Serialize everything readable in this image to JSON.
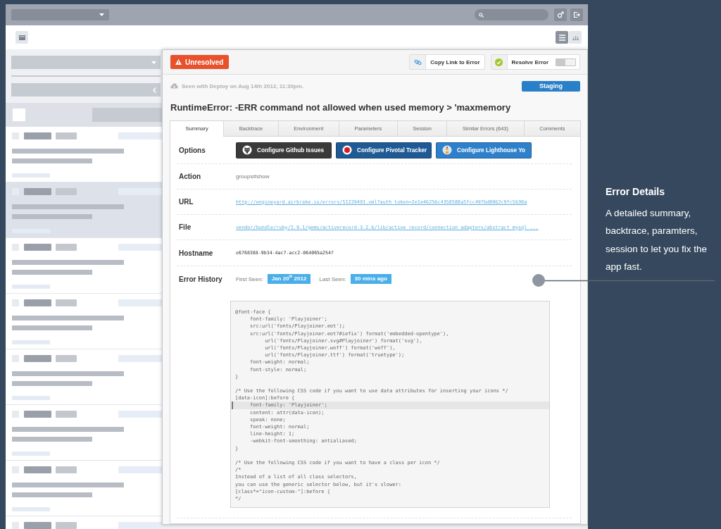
{
  "sidebar": {
    "header_checkbox": {
      "checked": false
    },
    "items": [
      {
        "selected": false
      },
      {
        "selected": true
      },
      {
        "selected": false
      },
      {
        "selected": false
      },
      {
        "selected": false
      },
      {
        "selected": false
      },
      {
        "selected": false
      },
      {
        "selected": false
      }
    ]
  },
  "error_panel": {
    "status_button": "Unresolved",
    "copy_link_button": "Copy Link to Error",
    "resolve": {
      "label": "Resolve Error",
      "on": false
    },
    "deploy_note": "Seen with Deploy on Aug 14th 2012, 11:30pm.",
    "environment_badge": "Staging",
    "title": "RuntimeError: -ERR command not allowed when used memory > 'maxmemory",
    "tabs": [
      {
        "label": "Summary",
        "selected": true
      },
      {
        "label": "Backtrace",
        "selected": false
      },
      {
        "label": "Environment",
        "selected": false
      },
      {
        "label": "Parameters",
        "selected": false
      },
      {
        "label": "Session",
        "selected": false
      },
      {
        "label": "Similar Errors (643)",
        "selected": false
      },
      {
        "label": "Comments",
        "selected": false
      }
    ],
    "options": {
      "label": "Options",
      "buttons": [
        {
          "label": "Configure Github Issues",
          "kind": "github"
        },
        {
          "label": "Configure Pivotal Tracker",
          "kind": "pivotal"
        },
        {
          "label": "Configure Lighthouse Yo",
          "kind": "lighthouse"
        }
      ]
    },
    "fields": [
      {
        "label": "Action",
        "value": "groups#show",
        "kind": "text"
      },
      {
        "label": "URL",
        "value": "http://engineyard.airbrake.io/errors/51229491.xml?auth_token=2e1e46256c4358588a5fcc497bd8062c9fc5630a",
        "kind": "link"
      },
      {
        "label": "File",
        "value": "vendor/bundle/ruby/1.9.1/gems/activerecord-3.2.6/lib/active_record/connection_adapters/abstract_mysql_...",
        "kind": "link"
      },
      {
        "label": "Hostname",
        "value": "e6768388-9b34-4ac7-acc2-064065a254f",
        "kind": "mono"
      }
    ],
    "error_history": {
      "label": "Error History",
      "first_seen_label": "First Seen:",
      "first_seen": "Jan 20$^{th}$ 2012",
      "last_seen_label": "Last Seen:",
      "last_seen": "30 mins ago"
    },
    "code_lines": [
      {
        "kind": "code",
        "text": "@font-face {",
        "highlighted": false
      },
      {
        "kind": "code",
        "text": "     font-family: 'Playjoiner';",
        "highlighted": false
      },
      {
        "kind": "code",
        "text": "     src:url('fonts/Playjoiner.eot');",
        "highlighted": false
      },
      {
        "kind": "code",
        "text": "     src:url('fonts/Playjoiner.eot?#iefix') format('embedded-opentype'),",
        "highlighted": false
      },
      {
        "kind": "code",
        "text": "          url('fonts/Playjoiner.svg#Playjoiner') format('svg'),",
        "highlighted": false
      },
      {
        "kind": "code",
        "text": "          url('fonts/Playjoiner.woff') format('woff'),",
        "highlighted": false
      },
      {
        "kind": "code",
        "text": "          url('fonts/Playjoiner.ttf') format('truetype');",
        "highlighted": false
      },
      {
        "kind": "code",
        "text": "     font-weight: normal;",
        "highlighted": false
      },
      {
        "kind": "code",
        "text": "     font-style: normal;",
        "highlighted": false
      },
      {
        "kind": "code",
        "text": "}",
        "highlighted": false
      },
      {
        "kind": "blank"
      },
      {
        "kind": "code",
        "text": "/* Use the following CSS code if you want to use data attributes for inserting your icons */",
        "highlighted": false
      },
      {
        "kind": "code",
        "text": "[data-icon]:before {",
        "highlighted": false
      },
      {
        "kind": "code",
        "text": "     font-family: 'Playjoiner';",
        "highlighted": true
      },
      {
        "kind": "code",
        "text": "     content: attr(data-icon);",
        "highlighted": false
      },
      {
        "kind": "code",
        "text": "     speak: none;",
        "highlighted": false
      },
      {
        "kind": "code",
        "text": "     font-weight: normal;",
        "highlighted": false
      },
      {
        "kind": "code",
        "text": "     line-height: 1;",
        "highlighted": false
      },
      {
        "kind": "code",
        "text": "     -webkit-font-smoothing: antialiased;",
        "highlighted": false
      },
      {
        "kind": "code",
        "text": "}",
        "highlighted": false
      },
      {
        "kind": "blank"
      },
      {
        "kind": "code",
        "text": "/* Use the following CSS code if you want to have a class per icon */",
        "highlighted": false
      },
      {
        "kind": "code",
        "text": "/*",
        "highlighted": false
      },
      {
        "kind": "code",
        "text": "Instead of a list of all class selectors,",
        "highlighted": false
      },
      {
        "kind": "code",
        "text": "you can use the generic selector below, but it's slower:",
        "highlighted": false
      },
      {
        "kind": "code",
        "text": "[class*=\"icon-custom-\"]:before {",
        "highlighted": false
      },
      {
        "kind": "code",
        "text": "*/",
        "highlighted": false
      }
    ]
  },
  "callout": {
    "title": "Error Details",
    "text": "A detailed summary, backtrace, paramters, session to let you fix the app fast."
  }
}
